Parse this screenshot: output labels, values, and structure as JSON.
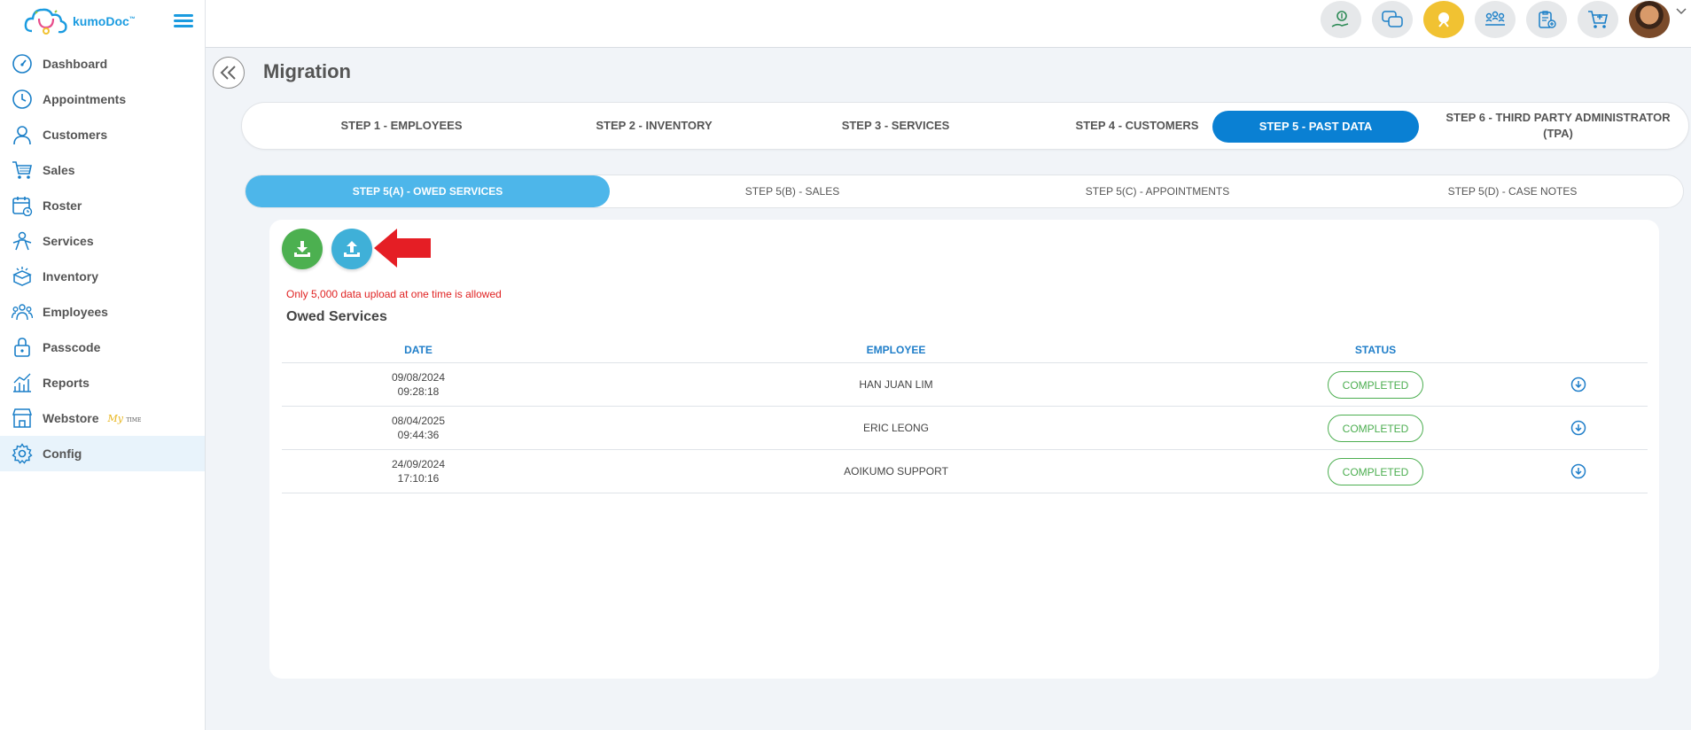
{
  "app": {
    "brand": "kumoDoc",
    "brand_tm": "™"
  },
  "sidebar": {
    "items": [
      {
        "label": "Dashboard",
        "icon": "dashboard-icon"
      },
      {
        "label": "Appointments",
        "icon": "clock-icon"
      },
      {
        "label": "Customers",
        "icon": "user-icon"
      },
      {
        "label": "Sales",
        "icon": "cart-icon"
      },
      {
        "label": "Roster",
        "icon": "calendar-icon"
      },
      {
        "label": "Services",
        "icon": "services-icon"
      },
      {
        "label": "Inventory",
        "icon": "box-icon"
      },
      {
        "label": "Employees",
        "icon": "team-icon"
      },
      {
        "label": "Passcode",
        "icon": "lock-icon"
      },
      {
        "label": "Reports",
        "icon": "chart-icon"
      },
      {
        "label": "Webstore",
        "icon": "store-icon",
        "badge": "My",
        "badge_sub": "TIME"
      },
      {
        "label": "Config",
        "icon": "gear-icon",
        "active": true
      }
    ]
  },
  "page": {
    "title": "Migration"
  },
  "steps": [
    {
      "label": "STEP 1 - EMPLOYEES"
    },
    {
      "label": "STEP 2 - INVENTORY"
    },
    {
      "label": "STEP 3 - SERVICES"
    },
    {
      "label": "STEP 4 - CUSTOMERS"
    },
    {
      "label": "STEP 5 - PAST DATA",
      "active": true
    },
    {
      "label": "STEP 6 - THIRD PARTY ADMINISTRATOR (TPA)"
    }
  ],
  "substeps": [
    {
      "label": "STEP 5(A) - OWED SERVICES",
      "active": true
    },
    {
      "label": "STEP 5(B) - SALES"
    },
    {
      "label": "STEP 5(C) - APPOINTMENTS"
    },
    {
      "label": "STEP 5(D) - CASE NOTES"
    }
  ],
  "content": {
    "notice": "Only 5,000 data upload at one time is allowed",
    "section_title": "Owed Services",
    "columns": [
      "DATE",
      "EMPLOYEE",
      "STATUS"
    ],
    "rows": [
      {
        "date": "09/08/2024",
        "time": "09:28:18",
        "employee": "HAN JUAN LIM",
        "status": "COMPLETED"
      },
      {
        "date": "08/04/2025",
        "time": "09:44:36",
        "employee": "ERIC LEONG",
        "status": "COMPLETED"
      },
      {
        "date": "24/09/2024",
        "time": "17:10:16",
        "employee": "AOIKUMO SUPPORT",
        "status": "COMPLETED"
      }
    ]
  },
  "colors": {
    "primary": "#0a80d3",
    "accent": "#4db6ea",
    "success": "#4cae50",
    "danger": "#e02323"
  }
}
